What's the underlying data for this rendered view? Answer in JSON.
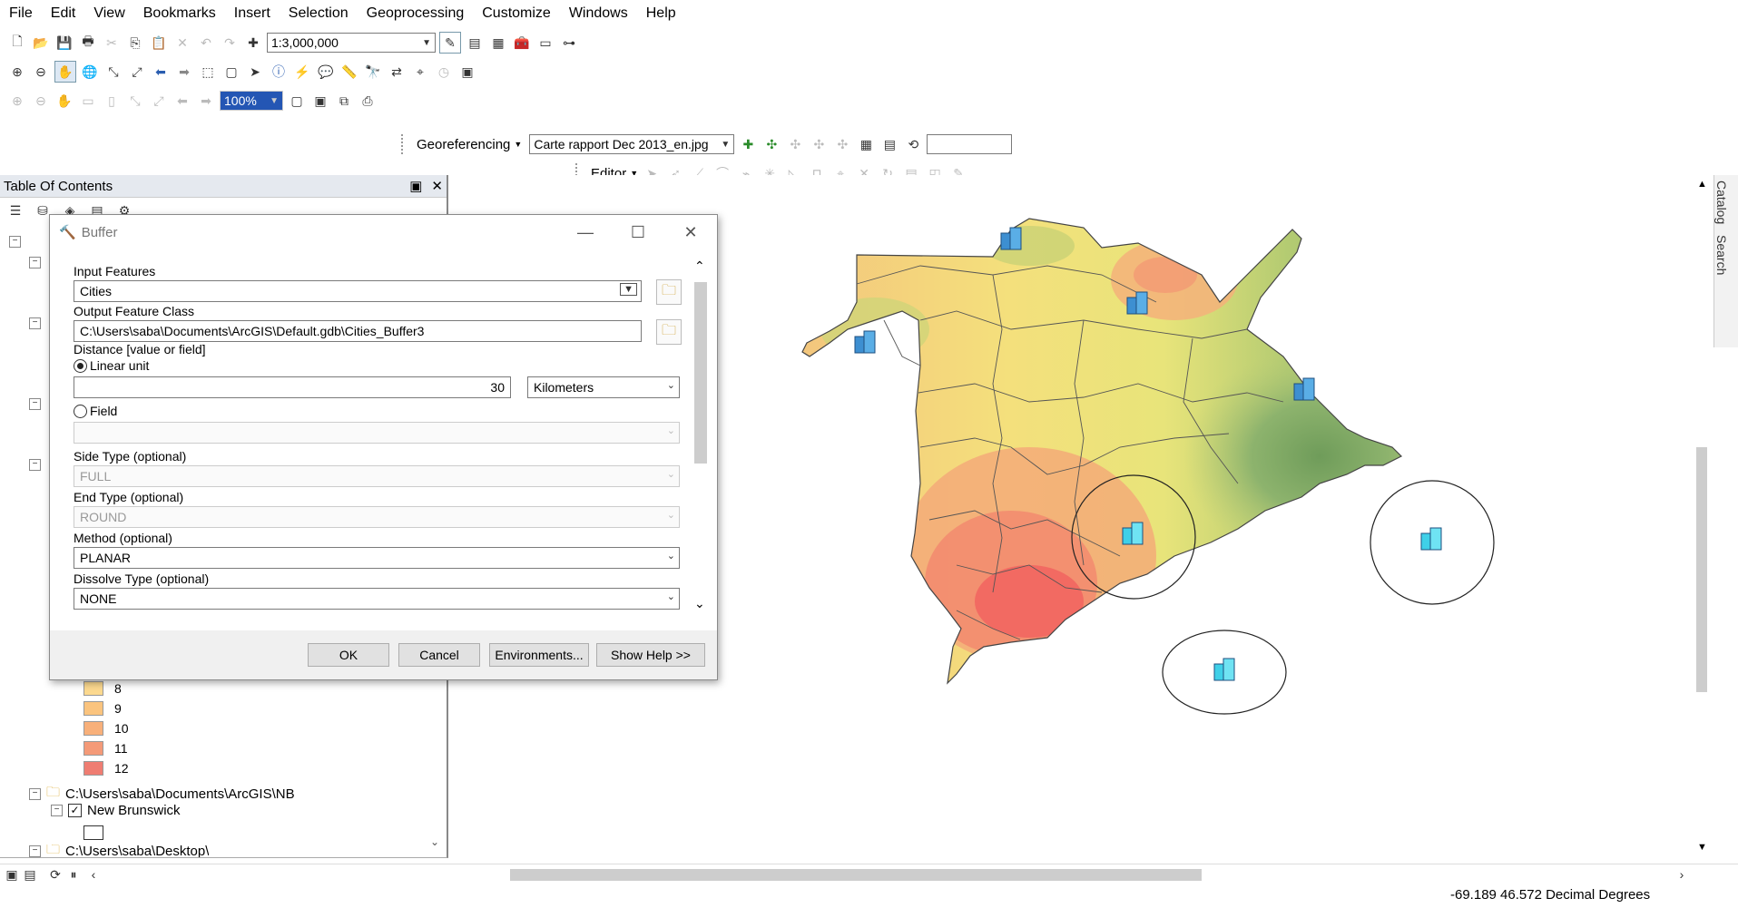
{
  "menu": [
    "File",
    "Edit",
    "View",
    "Bookmarks",
    "Insert",
    "Selection",
    "Geoprocessing",
    "Customize",
    "Windows",
    "Help"
  ],
  "toolbar": {
    "scale": "1:3,000,000",
    "zoom_percent": "100%",
    "georef_label": "Georeferencing",
    "georef_layer": "Carte rapport Dec 2013_en.jpg",
    "editor_label": "Editor"
  },
  "toc": {
    "title": "Table Of Contents",
    "legend": [
      {
        "label": "8",
        "color": "#fcd98f"
      },
      {
        "label": "9",
        "color": "#fbc47e"
      },
      {
        "label": "10",
        "color": "#f8b07a"
      },
      {
        "label": "11",
        "color": "#f49a78"
      },
      {
        "label": "12",
        "color": "#ef7d72"
      }
    ],
    "folder_path": "C:\\Users\\saba\\Documents\\ArcGIS\\NB",
    "layer_name": "New Brunswick",
    "folder_path2": "C:\\Users\\saba\\Desktop\\"
  },
  "dialog": {
    "title": "Buffer",
    "input_features_label": "Input Features",
    "input_features_value": "Cities",
    "output_label": "Output Feature Class",
    "output_value": "C:\\Users\\saba\\Documents\\ArcGIS\\Default.gdb\\Cities_Buffer3",
    "distance_label": "Distance [value or field]",
    "linear_unit_label": "Linear unit",
    "distance_value": "30",
    "unit_value": "Kilometers",
    "field_label": "Field",
    "side_type_label": "Side Type (optional)",
    "side_type_value": "FULL",
    "end_type_label": "End Type (optional)",
    "end_type_value": "ROUND",
    "method_label": "Method (optional)",
    "method_value": "PLANAR",
    "dissolve_label": "Dissolve Type (optional)",
    "dissolve_value": "NONE",
    "ok": "OK",
    "cancel": "Cancel",
    "environments": "Environments...",
    "show_help": "Show Help >>"
  },
  "right_tabs": [
    "Catalog",
    "Search"
  ],
  "status": {
    "coords": "-69.189  46.572 Decimal Degrees"
  },
  "colors": {
    "toc_header": "#e5e9ef",
    "dialog_bg": "#f0f0f0",
    "map_green": "#8bb36a",
    "map_yellow": "#f2e67a",
    "map_red": "#f2736a"
  }
}
